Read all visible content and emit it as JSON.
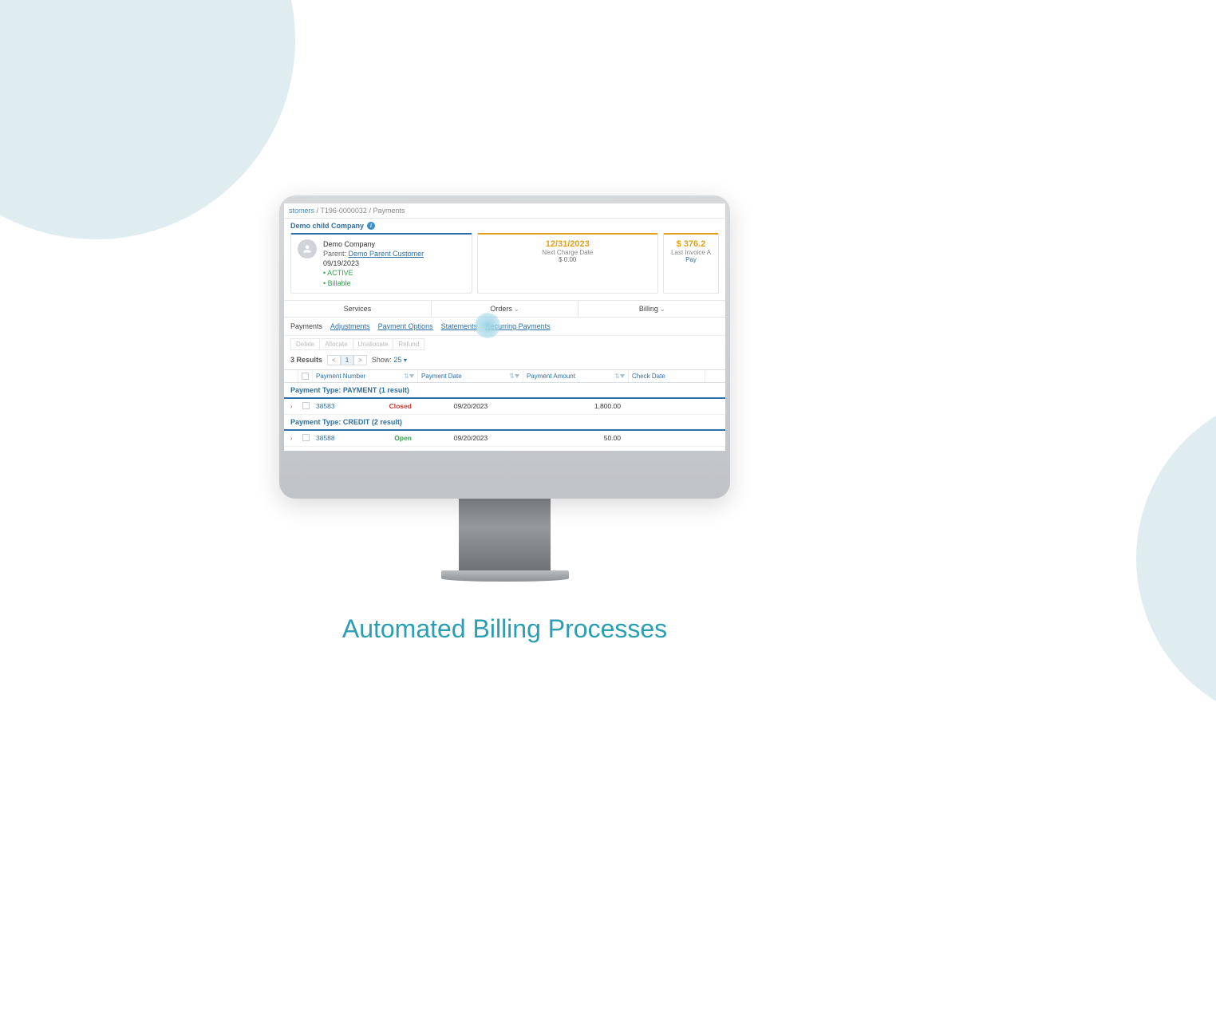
{
  "caption": "Automated Billing Processes",
  "breadcrumb": {
    "a": "stomers",
    "b": "T196-0000032",
    "c": "Payments"
  },
  "customer": {
    "title": "Demo child Company",
    "name": "Demo Company",
    "parent_label": "Parent:",
    "parent_link": "Demo Parent Customer",
    "date": "09/19/2023",
    "status1": "ACTIVE",
    "status2": "Billable"
  },
  "charge_card": {
    "date": "12/31/2023",
    "label": "Next Charge Date",
    "amount": "$ 0.00"
  },
  "invoice_card": {
    "amount": "$ 376.2",
    "label": "Last Invoice A",
    "pay": "Pay"
  },
  "main_tabs": {
    "services": "Services",
    "orders": "Orders",
    "billing": "Billing"
  },
  "subtabs": {
    "payments": "Payments",
    "adjustments": "Adjustments",
    "payment_options": "Payment Options",
    "statements": "Statements",
    "recurring": "Recurring Payments"
  },
  "toolbar": {
    "delete": "Delete",
    "allocate": "Allocate",
    "unallocate": "Unallocate",
    "refund": "Refund"
  },
  "pager": {
    "results": "3 Results",
    "prev": "<",
    "page": "1",
    "next": ">",
    "show_label": "Show:",
    "show_value": "25"
  },
  "columns": {
    "num": "Payment Number",
    "date": "Payment Date",
    "amount": "Payment Amount",
    "check": "Check Date"
  },
  "groups": [
    {
      "title": "Payment Type: PAYMENT (1 result)",
      "rows": [
        {
          "num": "38583",
          "status": "Closed",
          "status_class": "closed",
          "date": "09/20/2023",
          "amount": "1,800.00",
          "check": ""
        }
      ]
    },
    {
      "title": "Payment Type: CREDIT (2 result)",
      "rows": [
        {
          "num": "38588",
          "status": "Open",
          "status_class": "open",
          "date": "09/20/2023",
          "amount": "50.00",
          "check": ""
        }
      ]
    }
  ]
}
